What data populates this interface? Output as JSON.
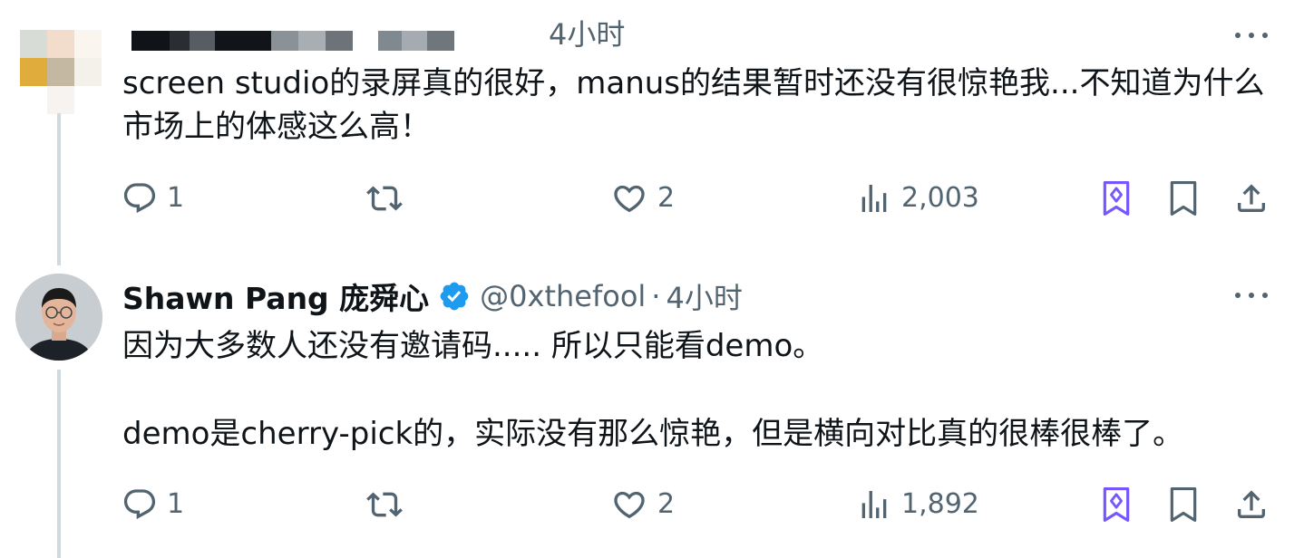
{
  "tweets": [
    {
      "author": {
        "name": "",
        "handle": "",
        "avatar": "pixelated"
      },
      "time": "4小时",
      "text": "screen studio的录屏真的很好，manus的结果暂时还没有很惊艳我...不知道为什么市场上的体感这么高！",
      "actions": {
        "replies": "1",
        "retweets": "",
        "likes": "2",
        "views": "2,003"
      }
    },
    {
      "author": {
        "name": "Shawn Pang 庞舜心",
        "handle": "@0xthefool",
        "verified": true,
        "avatar": "photo-avatar"
      },
      "separator": "·",
      "time": "4小时",
      "paragraphs": [
        "因为大多数人还没有邀请码..... 所以只能看demo。",
        "demo是cherry-pick的，实际没有那么惊艳，但是横向对比真的很棒很棒了。"
      ],
      "actions": {
        "replies": "1",
        "retweets": "",
        "likes": "2",
        "views": "1,892"
      }
    }
  ],
  "icons": {
    "reply": "reply-icon",
    "retweet": "retweet-icon",
    "like": "heart-icon",
    "views": "views-icon",
    "grok": "grok-icon",
    "bookmark": "bookmark-icon",
    "share": "share-icon",
    "more": "more-icon",
    "verified": "verified-badge-icon"
  },
  "colors": {
    "text": "#0f1419",
    "muted": "#536471",
    "accent": "#1d9bf0",
    "grok": "#7856ff",
    "thread": "#cfd9de"
  }
}
